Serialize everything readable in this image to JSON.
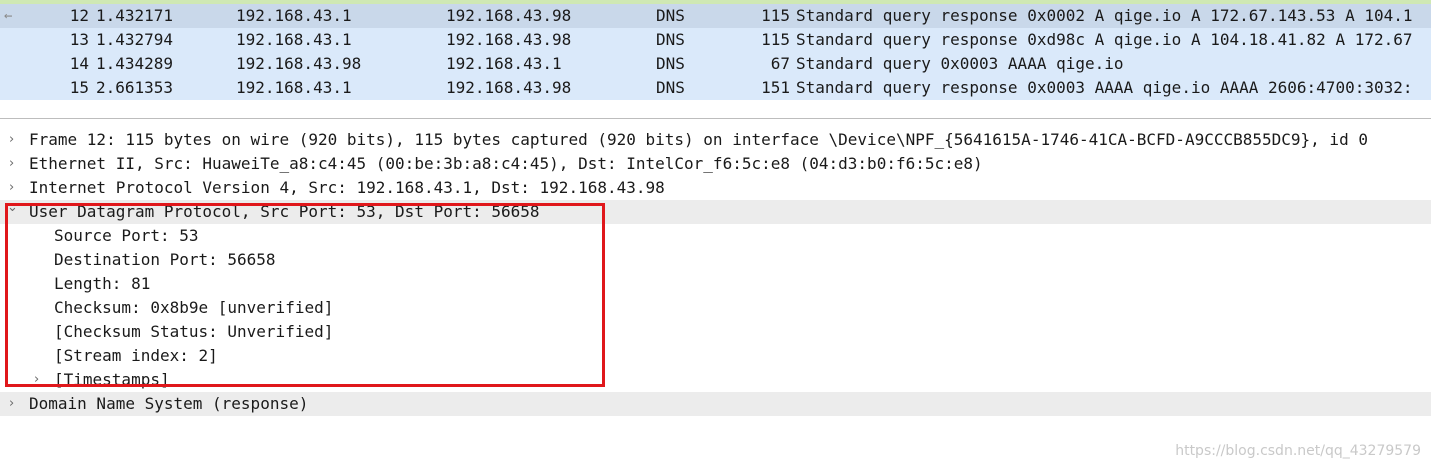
{
  "packet_list": {
    "rows": [
      {
        "no": "12",
        "time": "1.432171",
        "source": "192.168.43.1",
        "destination": "192.168.43.98",
        "protocol": "DNS",
        "length": "115",
        "info": "Standard query response 0x0002 A qige.io A 172.67.143.53 A 104.1"
      },
      {
        "no": "13",
        "time": "1.432794",
        "source": "192.168.43.1",
        "destination": "192.168.43.98",
        "protocol": "DNS",
        "length": "115",
        "info": "Standard query response 0xd98c A qige.io A 104.18.41.82 A 172.67"
      },
      {
        "no": "14",
        "time": "1.434289",
        "source": "192.168.43.98",
        "destination": "192.168.43.1",
        "protocol": "DNS",
        "length": "67",
        "info": "Standard query 0x0003 AAAA qige.io"
      },
      {
        "no": "15",
        "time": "2.661353",
        "source": "192.168.43.1",
        "destination": "192.168.43.98",
        "protocol": "DNS",
        "length": "151",
        "info": "Standard query response 0x0003 AAAA qige.io AAAA 2606:4700:3032:"
      }
    ],
    "related_arrow": "←"
  },
  "details": {
    "frame": "Frame 12: 115 bytes on wire (920 bits), 115 bytes captured (920 bits) on interface \\Device\\NPF_{5641615A-1746-41CA-BCFD-A9CCCB855DC9}, id 0",
    "ethernet": "Ethernet II, Src: HuaweiTe_a8:c4:45 (00:be:3b:a8:c4:45), Dst: IntelCor_f6:5c:e8 (04:d3:b0:f6:5c:e8)",
    "ip": "Internet Protocol Version 4, Src: 192.168.43.1, Dst: 192.168.43.98",
    "udp": "User Datagram Protocol, Src Port: 53, Dst Port: 56658",
    "udp_fields": {
      "source_port": "Source Port: 53",
      "destination_port": "Destination Port: 56658",
      "length": "Length: 81",
      "checksum": "Checksum: 0x8b9e [unverified]",
      "checksum_status": "[Checksum Status: Unverified]",
      "stream_index": "[Stream index: 2]",
      "timestamps": "[Timestamps]"
    },
    "dns": "Domain Name System (response)"
  },
  "twisty": {
    "collapsed": "›",
    "expanded": "⌄"
  },
  "watermark": "https://blog.csdn.net/qq_43279579",
  "colors": {
    "selected_row": "#c9d8ea",
    "packet_row": "#dae9fa",
    "highlight_box": "#e0171b"
  }
}
